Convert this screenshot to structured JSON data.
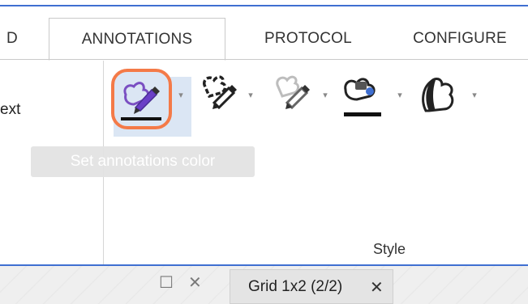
{
  "tabs": [
    {
      "label": "D"
    },
    {
      "label": "ANNOTATIONS"
    },
    {
      "label": "PROTOCOL"
    },
    {
      "label": "CONFIGURE"
    }
  ],
  "ribbon": {
    "left_text": "ext",
    "group_label": "Style",
    "tooltip": "Set annotations color",
    "tools": [
      {
        "name": "annotations-color-icon",
        "selected": true
      },
      {
        "name": "line-style-icon"
      },
      {
        "name": "line-fade-icon"
      },
      {
        "name": "fill-color-icon"
      },
      {
        "name": "opacity-icon"
      }
    ],
    "colors": {
      "accent": "#3f6fd1",
      "highlight": "#f47a48",
      "selected_bg": "#dbe6f4",
      "pen": "#6a3fc7"
    }
  },
  "bottom": {
    "restore_glyph": "☐",
    "close_glyph": "✕",
    "grid_tab_label": "Grid 1x2 (2/2)",
    "grid_tab_close": "✕"
  }
}
